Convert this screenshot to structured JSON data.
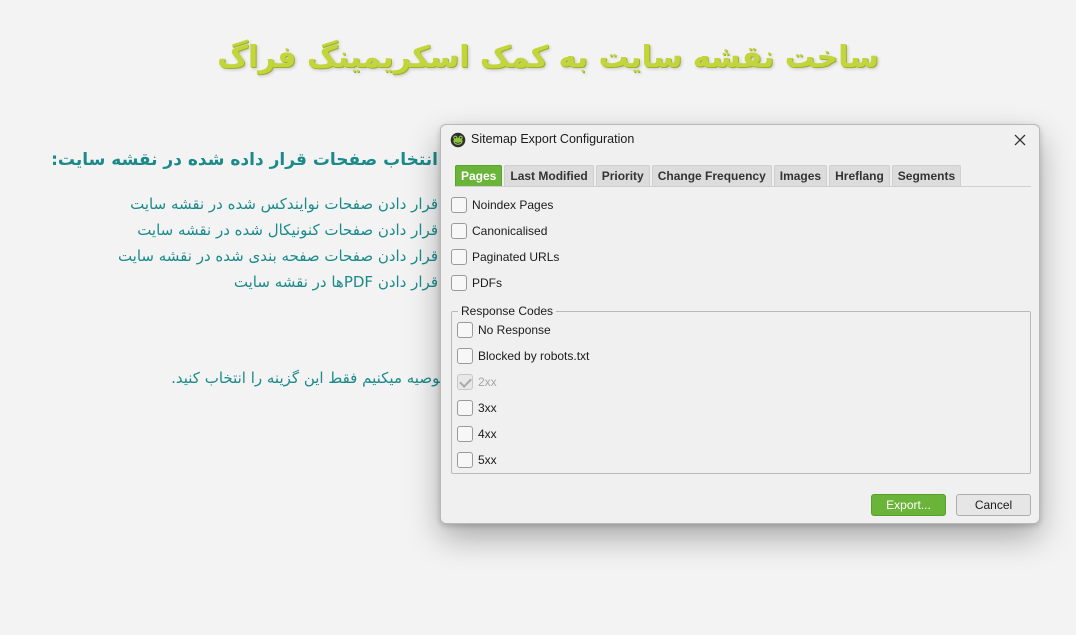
{
  "banner": {
    "title": "ساخت نقشه سایت به کمک اسکریمینگ فراگ",
    "heading": "انتخاب صفحات قرار داده شده در نقشه سایت:",
    "bullets": [
      "قرار دادن صفحات نوایندکس شده در نقشه سایت",
      "قرار دادن صفحات کنونیکال شده در نقشه سایت",
      "قرار دادن صفحات صفحه بندی شده در نقشه سایت",
      "قرار دادن PDFها در نقشه سایت"
    ],
    "recommendation": "توصیه میکنیم فقط این گزینه را انتخاب کنید."
  },
  "dialog": {
    "title": "Sitemap Export Configuration",
    "app_icon": "screaming-frog-icon",
    "close_icon": "close-icon",
    "tabs": [
      {
        "label": "Pages",
        "active": true
      },
      {
        "label": "Last Modified",
        "active": false
      },
      {
        "label": "Priority",
        "active": false
      },
      {
        "label": "Change Frequency",
        "active": false
      },
      {
        "label": "Images",
        "active": false
      },
      {
        "label": "Hreflang",
        "active": false
      },
      {
        "label": "Segments",
        "active": false
      }
    ],
    "options": [
      {
        "label": "Noindex Pages",
        "checked": false
      },
      {
        "label": "Canonicalised",
        "checked": false
      },
      {
        "label": "Paginated URLs",
        "checked": false
      },
      {
        "label": "PDFs",
        "checked": false
      }
    ],
    "response_codes": {
      "legend": "Response Codes",
      "items": [
        {
          "label": "No Response",
          "checked": false,
          "disabled": false
        },
        {
          "label": "Blocked by robots.txt",
          "checked": false,
          "disabled": false
        },
        {
          "label": "2xx",
          "checked": true,
          "disabled": true
        },
        {
          "label": "3xx",
          "checked": false,
          "disabled": false
        },
        {
          "label": "4xx",
          "checked": false,
          "disabled": false
        },
        {
          "label": "5xx",
          "checked": false,
          "disabled": false
        }
      ]
    },
    "buttons": {
      "export": "Export...",
      "cancel": "Cancel"
    },
    "colors": {
      "accent": "#6bb43a",
      "banner_title": "#c2d63c",
      "banner_text": "#1a8a8a"
    }
  }
}
